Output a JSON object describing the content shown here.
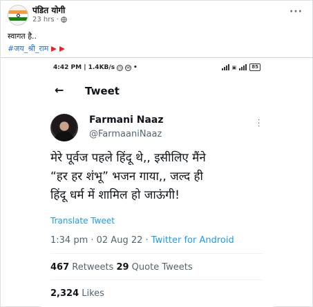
{
  "post": {
    "author": "पंडित योगी",
    "time": "23 hrs ·",
    "text": "स्वागत है..",
    "hashtag": "#जय_श्री_राम"
  },
  "phone_status": {
    "time": "4:42 PM | 1.4KB/s",
    "battery": "85"
  },
  "tweet": {
    "header_title": "Tweet",
    "author_name": "Farmani Naaz",
    "author_handle": "@FarmaaniNaaz",
    "body_line1": "मेरे पूर्वज पहले हिंदू थे,, इसीलिए मैंने",
    "body_line2": "“हर हर शंभू” भजन गाया,, जल्द ही",
    "body_line3": "हिंदू धर्म में शामिल हो जाऊंगी!",
    "translate_label": "Translate Tweet",
    "timestamp": "1:34 pm · 02 Aug 22 · ",
    "source": "Twitter for Android",
    "retweets_count": "467",
    "retweets_label": " Retweets ",
    "quotes_count": "29",
    "quotes_label": " Quote Tweets",
    "likes_count": "2,324",
    "likes_label": " Likes"
  }
}
